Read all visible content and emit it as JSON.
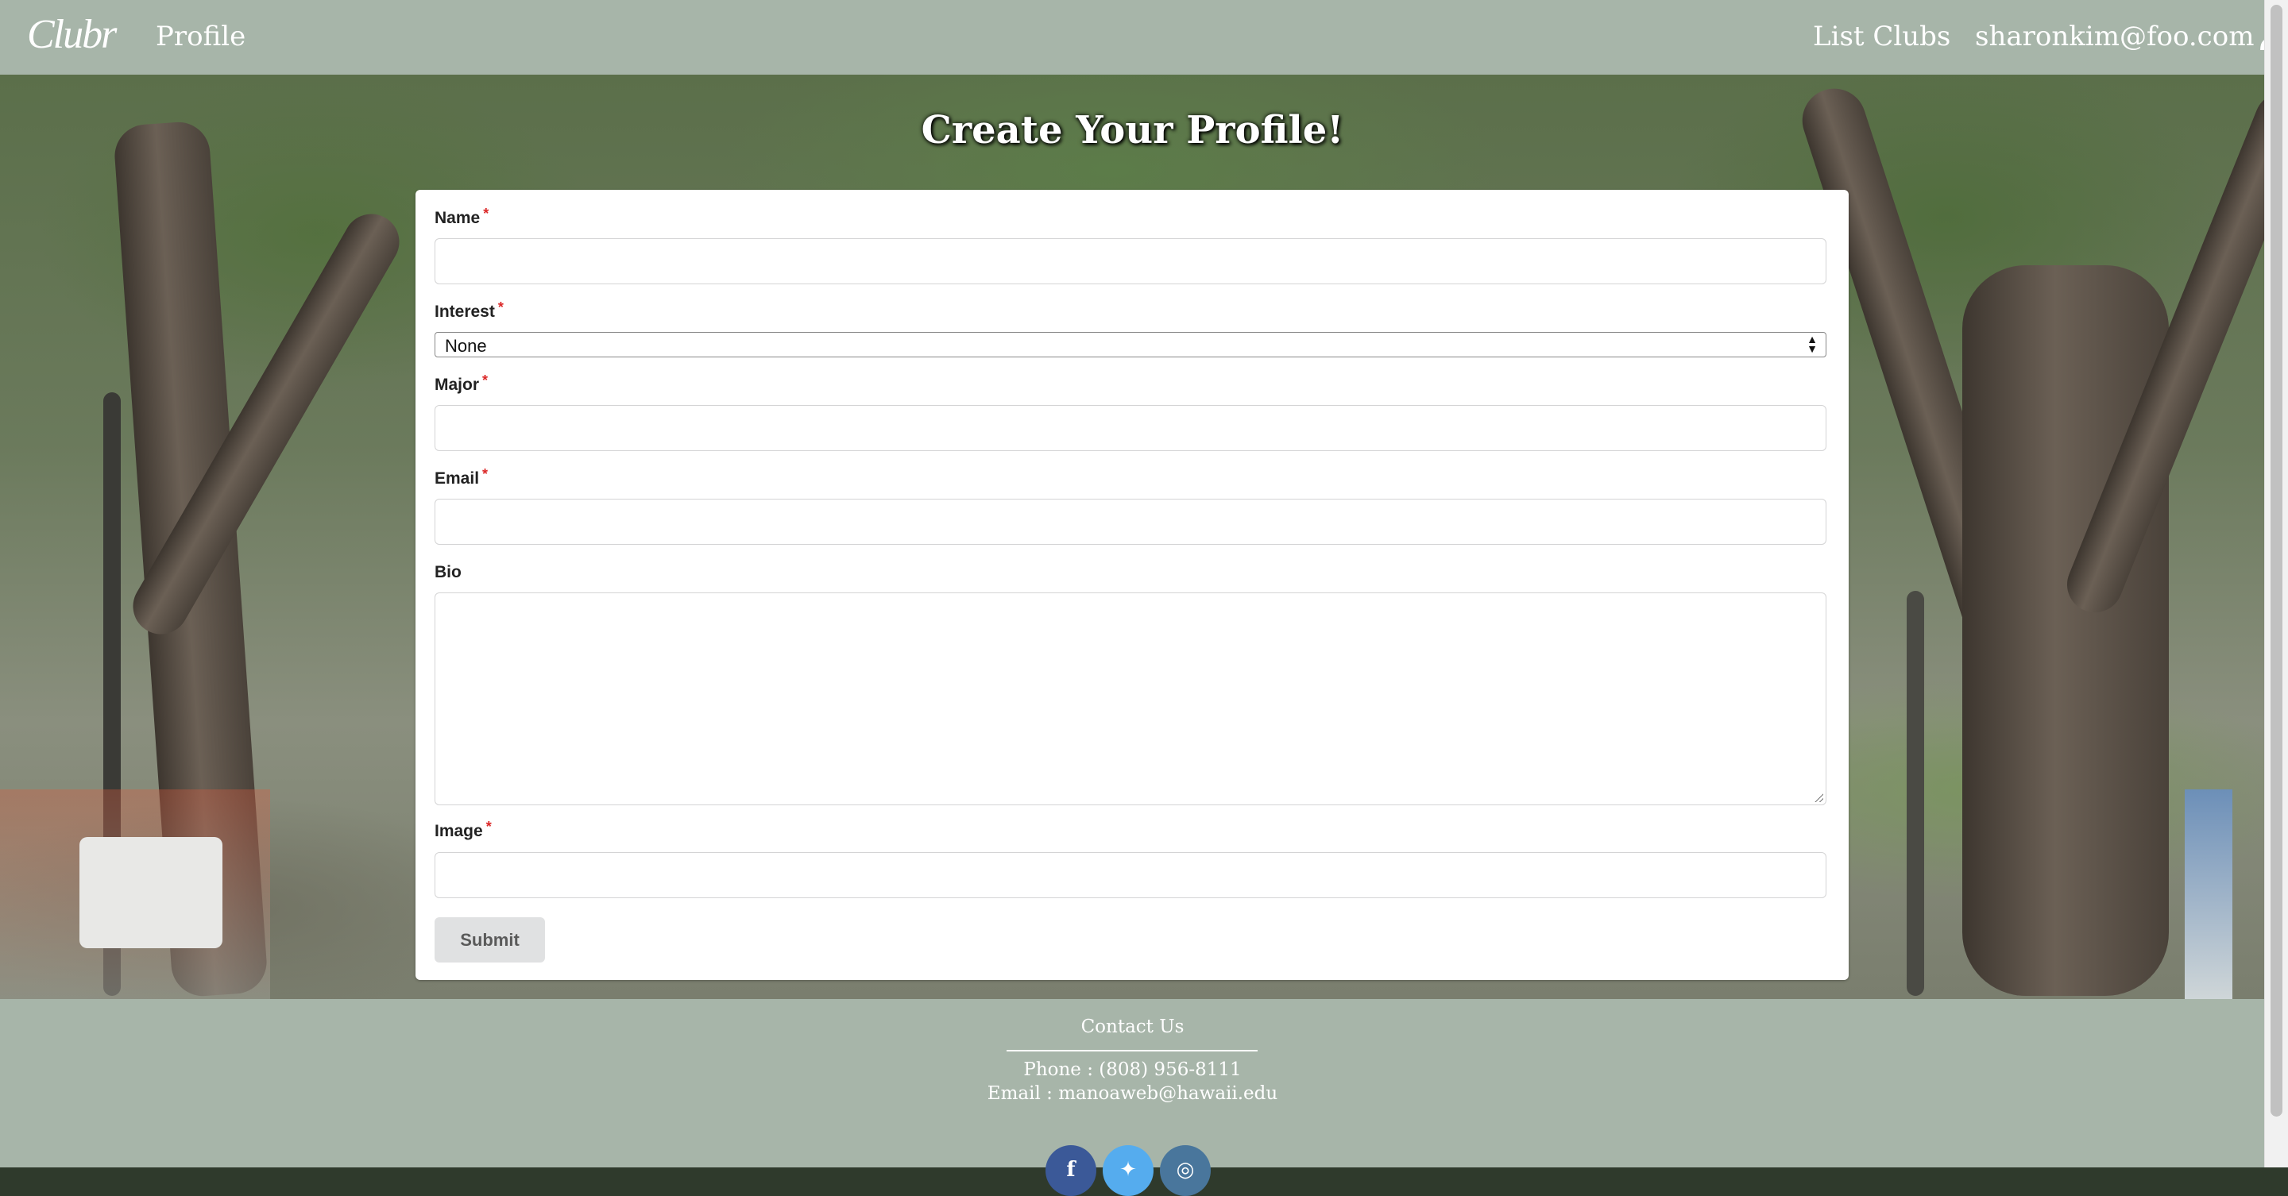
{
  "navbar": {
    "brand": "Clubr",
    "profile_link": "Profile",
    "list_clubs_link": "List Clubs",
    "user_email": "sharonkim@foo.com",
    "user_icon": "user-icon"
  },
  "page": {
    "title": "Create Your Profile!"
  },
  "form": {
    "required_marker": "*",
    "name_label": "Name",
    "name_value": "",
    "interest_label": "Interest",
    "interest_selected": "None",
    "major_label": "Major",
    "major_value": "",
    "email_label": "Email",
    "email_value": "",
    "bio_label": "Bio",
    "bio_value": "",
    "image_label": "Image",
    "image_value": "",
    "submit_label": "Submit"
  },
  "footer": {
    "title": "Contact Us",
    "phone": "Phone : (808) 956-8111",
    "email": "Email : manoaweb@hawaii.edu",
    "social_icons": [
      "facebook-icon",
      "twitter-icon",
      "instagram-icon"
    ]
  },
  "colors": {
    "nav_footer_bg": "#a7b5a9",
    "required": "#db2828",
    "button_bg": "#e0e1e2",
    "facebook": "#3b5998",
    "twitter": "#55acee",
    "instagram": "#49769c"
  }
}
